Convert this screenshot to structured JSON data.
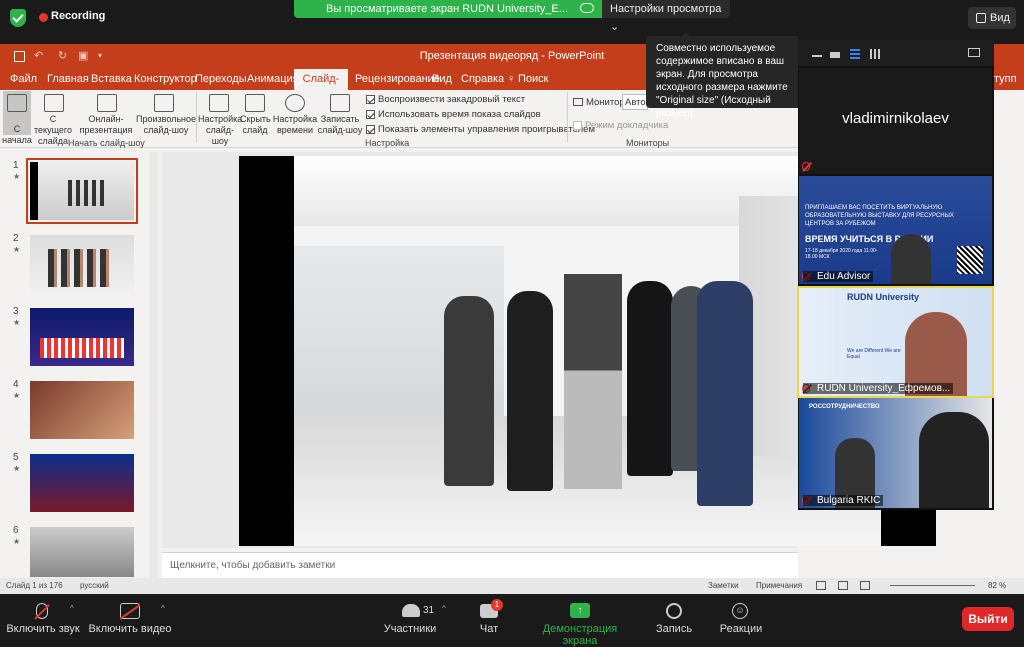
{
  "zoom": {
    "recording_label": "Recording",
    "share_banner": "Вы просматриваете экран RUDN University_E...",
    "view_options_label": "Настройки просмотра",
    "view_button_label": "Вид",
    "popup_text": "Совместно используемое содержимое вписано в ваш экран. Для просмотра исходного размера нажмите \"Original size\" (Исходный размер).",
    "bottom": {
      "mute_label": "Включить звук",
      "video_label": "Включить видео",
      "participants_label": "Участники",
      "participants_count": "31",
      "chat_label": "Чат",
      "chat_badge": "1",
      "share_label": "Демонстрация экрана",
      "record_label": "Запись",
      "reactions_label": "Реакции",
      "exit_label": "Выйти"
    },
    "gallery": [
      {
        "name": "vladimirnikolaev",
        "type": "name-only"
      },
      {
        "name": "Edu Advisor",
        "type": "video",
        "poster_text": "ВРЕМЯ УЧИТЬСЯ В РОССИИ",
        "poster_sub": "ПРИГЛАШАЕМ ВАС ПОСЕТИТЬ ВИРТУАЛЬНУЮ ОБРАЗОВАТЕЛЬНУЮ ВЫСТАВКУ ДЛЯ РЕСУРСНЫХ ЦЕНТРОВ ЗА РУБЕЖОМ",
        "poster_date": "17-18 декабря 2020 года 11.00-18.00 МСК"
      },
      {
        "name": "RUDN University_Ефремов...",
        "type": "video",
        "poster_text": "RUDN University",
        "poster_sub": "We are Different We are Equal"
      },
      {
        "name": "Bulgaria RKIC",
        "type": "video",
        "poster_text": "РОССОТРУДНИЧЕСТВО"
      }
    ],
    "colors": {
      "share_green": "#2db34a",
      "exit_red": "#e02828",
      "recording_red": "#e0392b"
    }
  },
  "ppt": {
    "window_title": "Презентация видеоряд  -  PowerPoint",
    "menu": [
      "Файл",
      "Главная",
      "Вставка",
      "Конструктор",
      "Переходы",
      "Анимация",
      "Слайд-шоу",
      "Рецензирование",
      "Вид",
      "Справка",
      "Поиск"
    ],
    "active_tab": "Слайд-шоу",
    "share_partial": "тупп",
    "ribbon": {
      "from_start": "С начала",
      "from_current": "С текущего слайда",
      "online": "Онлайн-презентация",
      "custom": "Произвольное слайд-шоу",
      "group_start": "Начать слайд-шоу",
      "setup": "Настройка слайд-шоу",
      "hide": "Скрыть слайд",
      "rehearse": "Настройка времени",
      "record": "Записать слайд-шоу",
      "check1": "Воспроизвести закадровый текст",
      "check2": "Использовать время показа слайдов",
      "check3": "Показать элементы управления проигрывателем",
      "group_setup": "Настройка",
      "monitor_label": "Монитор:",
      "monitor_value": "Автом",
      "presenter_view": "Режим докладчика",
      "group_monitors": "Мониторы"
    },
    "slides": [
      {
        "num": "1",
        "star": "★"
      },
      {
        "num": "2",
        "star": "★"
      },
      {
        "num": "3",
        "star": "★"
      },
      {
        "num": "4",
        "star": "★"
      },
      {
        "num": "5",
        "star": "★"
      },
      {
        "num": "6",
        "star": "★"
      }
    ],
    "notes_placeholder": "Щелкните, чтобы добавить заметки",
    "status": {
      "slide_counter": "Слайд 1 из 176",
      "language": "русский",
      "notes_btn": "Заметки",
      "comments_btn": "Примечания",
      "zoom": "82 %"
    }
  }
}
